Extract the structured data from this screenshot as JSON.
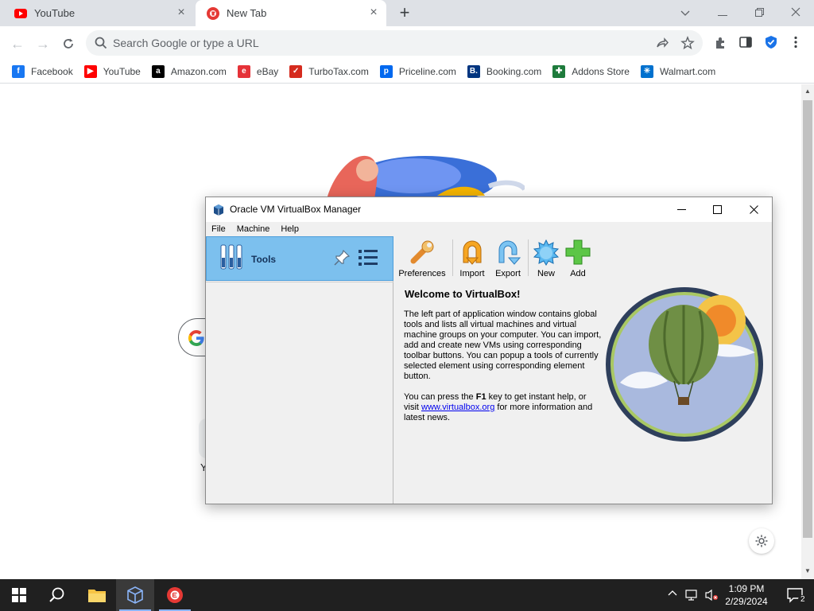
{
  "browser": {
    "tabs": [
      {
        "label": "YouTube"
      },
      {
        "label": "New Tab"
      }
    ],
    "omnibox_placeholder": "Search Google or type a URL",
    "bookmarks": [
      {
        "label": "Facebook",
        "icon": "facebook-icon",
        "color": "#1877f2",
        "glyph": "f"
      },
      {
        "label": "YouTube",
        "icon": "youtube-icon",
        "color": "#ff0000",
        "glyph": "▶"
      },
      {
        "label": "Amazon.com",
        "icon": "amazon-icon",
        "color": "#000000",
        "glyph": "a"
      },
      {
        "label": "eBay",
        "icon": "ebay-icon",
        "color": "#e53238",
        "glyph": "e"
      },
      {
        "label": "TurboTax.com",
        "icon": "turbotax-icon",
        "color": "#d52b1e",
        "glyph": "✓"
      },
      {
        "label": "Priceline.com",
        "icon": "priceline-icon",
        "color": "#0068ef",
        "glyph": "p"
      },
      {
        "label": "Booking.com",
        "icon": "booking-icon",
        "color": "#003580",
        "glyph": "B."
      },
      {
        "label": "Addons Store",
        "icon": "addons-icon",
        "color": "#1e7b3c",
        "glyph": "✚"
      },
      {
        "label": "Walmart.com",
        "icon": "walmart-icon",
        "color": "#0071ce",
        "glyph": "✳"
      }
    ]
  },
  "vbox": {
    "title": "Oracle VM VirtualBox Manager",
    "menu": [
      "File",
      "Machine",
      "Help"
    ],
    "tools_label": "Tools",
    "toolbar": [
      "Preferences",
      "Import",
      "Export",
      "New",
      "Add"
    ],
    "welcome_title": "Welcome to VirtualBox!",
    "p1": "The left part of application window contains global tools and lists all virtual machines and virtual machine groups on your computer. You can import, add and create new VMs using corresponding toolbar buttons. You can popup a tools of currently selected element using corresponding element button.",
    "p2_a": "You can press the ",
    "p2_key": "F1",
    "p2_b": " key to get instant help, or visit ",
    "p2_link": "www.virtualbox.org",
    "p2_c": " for more information and latest news."
  },
  "taskbar": {
    "time": "1:09 PM",
    "date": "2/29/2024",
    "notification_count": "2"
  },
  "colors": {
    "tools_highlight": "#7cc0ee",
    "taskbar": "#202020",
    "tab_strip": "#dee1e6"
  }
}
